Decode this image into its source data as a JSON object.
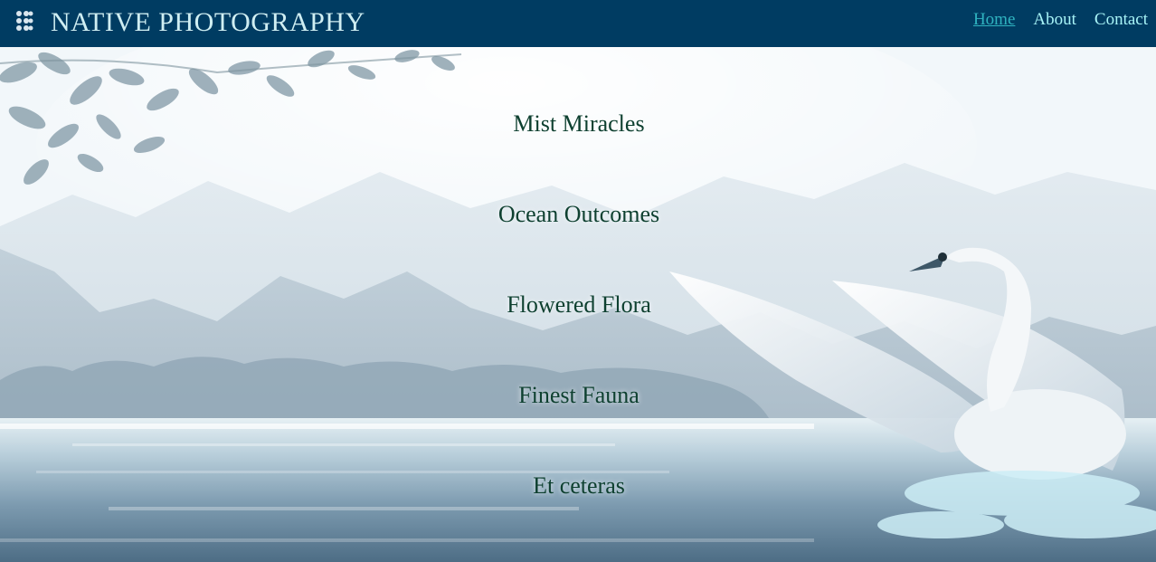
{
  "navbar": {
    "brand": "NATIVE PHOTOGRAPHY",
    "menu_icon": "hamburger-dots-icon",
    "links": [
      {
        "label": "Home",
        "active": true
      },
      {
        "label": "About",
        "active": false
      },
      {
        "label": "Contact",
        "active": false
      }
    ]
  },
  "categories": [
    {
      "label": "Mist Miracles"
    },
    {
      "label": "Ocean Outcomes"
    },
    {
      "label": "Flowered Flora"
    },
    {
      "label": "Finest Fauna"
    },
    {
      "label": "Et ceteras"
    }
  ],
  "colors": {
    "navbar_bg": "#003c62",
    "brand_text": "#cfeef2",
    "nav_link": "#a8f4f7",
    "nav_link_active": "#2fb3c0",
    "category_text": "#0e4030"
  }
}
